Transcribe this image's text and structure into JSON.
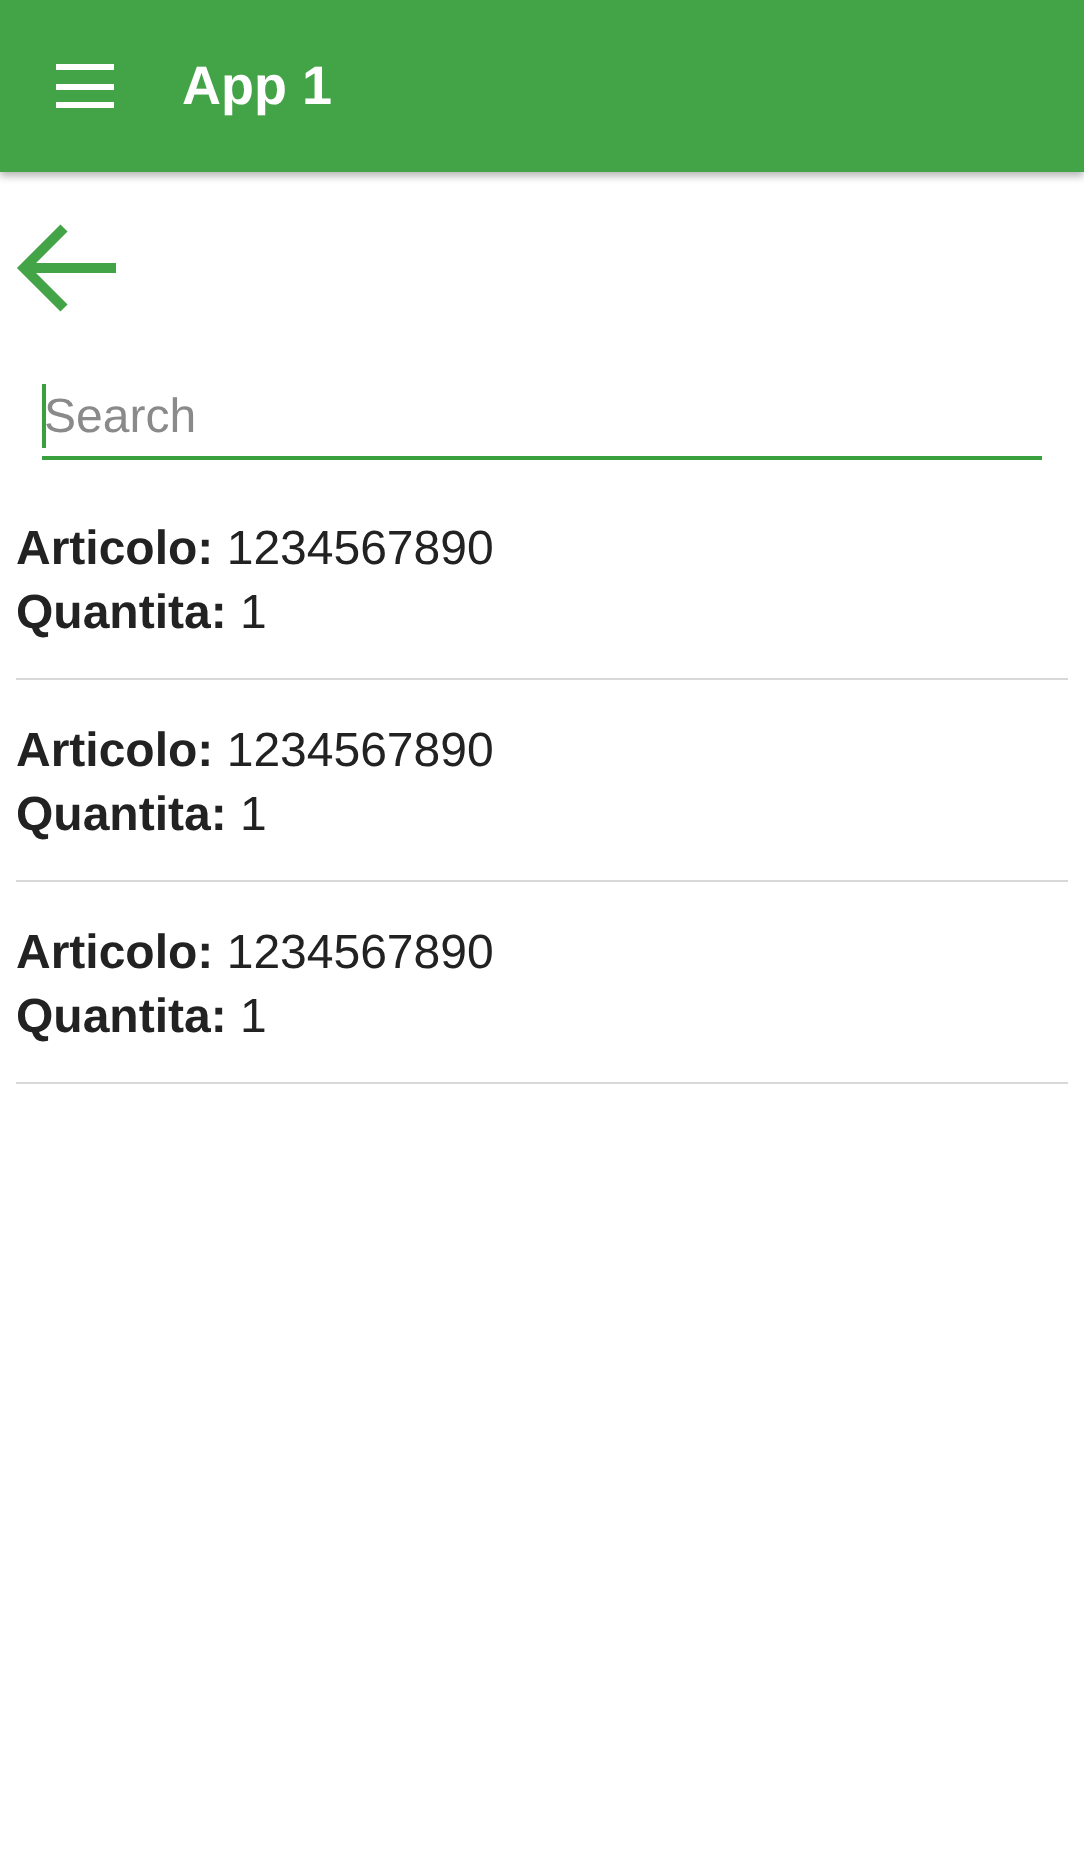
{
  "app_bar": {
    "title": "App 1"
  },
  "search": {
    "placeholder": "Search",
    "focused": true
  },
  "items": [
    {
      "article": "**Articolo:** 1234567890",
      "quantity": "**Quantita:** 1"
    },
    {
      "article": "**Articolo:** 1234567890",
      "quantity": "**Quantita:** 1"
    },
    {
      "article": "**Articolo:** 1234567890",
      "quantity": "**Quantita:** 1"
    }
  ]
}
